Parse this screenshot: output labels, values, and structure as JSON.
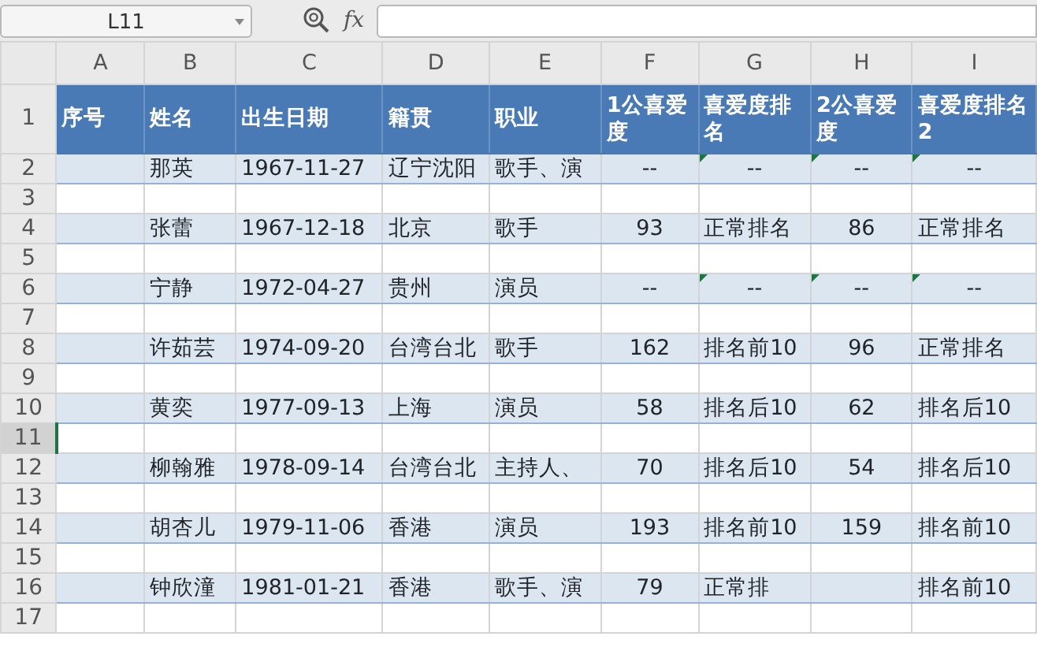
{
  "name_box": {
    "value": "L11"
  },
  "formula_bar": {
    "label": "fx"
  },
  "columns": [
    {
      "label": "A",
      "selected": false
    },
    {
      "label": "B",
      "selected": false
    },
    {
      "label": "C",
      "selected": false
    },
    {
      "label": "D",
      "selected": false
    },
    {
      "label": "E",
      "selected": false
    },
    {
      "label": "F",
      "selected": false
    },
    {
      "label": "G",
      "selected": false
    },
    {
      "label": "H",
      "selected": false
    },
    {
      "label": "I",
      "selected": false
    }
  ],
  "rows": [
    {
      "number": "1",
      "kind": "header",
      "selected": false,
      "cells": [
        "序号",
        "姓名",
        "出生日期",
        "籍贯",
        "职业",
        "1公喜爱度",
        "喜爱度排名",
        "2公喜爱度",
        "喜爱度排名2"
      ]
    },
    {
      "number": "2",
      "kind": "band",
      "selected": false,
      "cells": [
        null,
        "那英",
        "1967-11-27",
        "辽宁沈阳",
        "歌手、演",
        "--",
        {
          "text": "--",
          "error_flag": true
        },
        {
          "text": "--",
          "error_flag": true
        },
        {
          "text": "--",
          "error_flag": true
        }
      ]
    },
    {
      "number": "3",
      "kind": "plain",
      "selected": false,
      "cells": []
    },
    {
      "number": "4",
      "kind": "band",
      "selected": false,
      "cells": [
        null,
        "张蕾",
        "1967-12-18",
        "北京",
        "歌手",
        "93",
        "正常排名",
        "86",
        "正常排名"
      ]
    },
    {
      "number": "5",
      "kind": "plain",
      "selected": false,
      "cells": []
    },
    {
      "number": "6",
      "kind": "band",
      "selected": false,
      "cells": [
        null,
        "宁静",
        "1972-04-27",
        "贵州",
        "演员",
        "--",
        {
          "text": "--",
          "error_flag": true
        },
        {
          "text": "--",
          "error_flag": true
        },
        {
          "text": "--",
          "error_flag": true
        }
      ]
    },
    {
      "number": "7",
      "kind": "plain",
      "selected": false,
      "cells": []
    },
    {
      "number": "8",
      "kind": "band",
      "selected": false,
      "cells": [
        null,
        "许茹芸",
        "1974-09-20",
        "台湾台北",
        "歌手",
        "162",
        "排名前10",
        "96",
        "正常排名"
      ]
    },
    {
      "number": "9",
      "kind": "plain",
      "selected": false,
      "cells": []
    },
    {
      "number": "10",
      "kind": "band",
      "selected": false,
      "cells": [
        null,
        "黄奕",
        "1977-09-13",
        "上海",
        "演员",
        "58",
        "排名后10",
        "62",
        "排名后10"
      ]
    },
    {
      "number": "11",
      "kind": "plain",
      "selected": true,
      "cells": []
    },
    {
      "number": "12",
      "kind": "band",
      "selected": false,
      "cells": [
        null,
        "柳翰雅",
        "1978-09-14",
        "台湾台北",
        "主持人、",
        "70",
        "排名后10",
        "54",
        "排名后10"
      ]
    },
    {
      "number": "13",
      "kind": "plain",
      "selected": false,
      "cells": []
    },
    {
      "number": "14",
      "kind": "band",
      "selected": false,
      "cells": [
        null,
        "胡杏儿",
        "1979-11-06",
        "香港",
        "演员",
        "193",
        "排名前10",
        "159",
        "排名前10"
      ]
    },
    {
      "number": "15",
      "kind": "plain",
      "selected": false,
      "cells": []
    },
    {
      "number": "16",
      "kind": "band",
      "selected": false,
      "cells": [
        null,
        "钟欣潼",
        "1981-01-21",
        "香港",
        "歌手、演",
        "79",
        "正常排",
        null,
        "排名前10"
      ]
    },
    {
      "number": "17",
      "kind": "plain",
      "selected": false,
      "cells": []
    }
  ]
}
